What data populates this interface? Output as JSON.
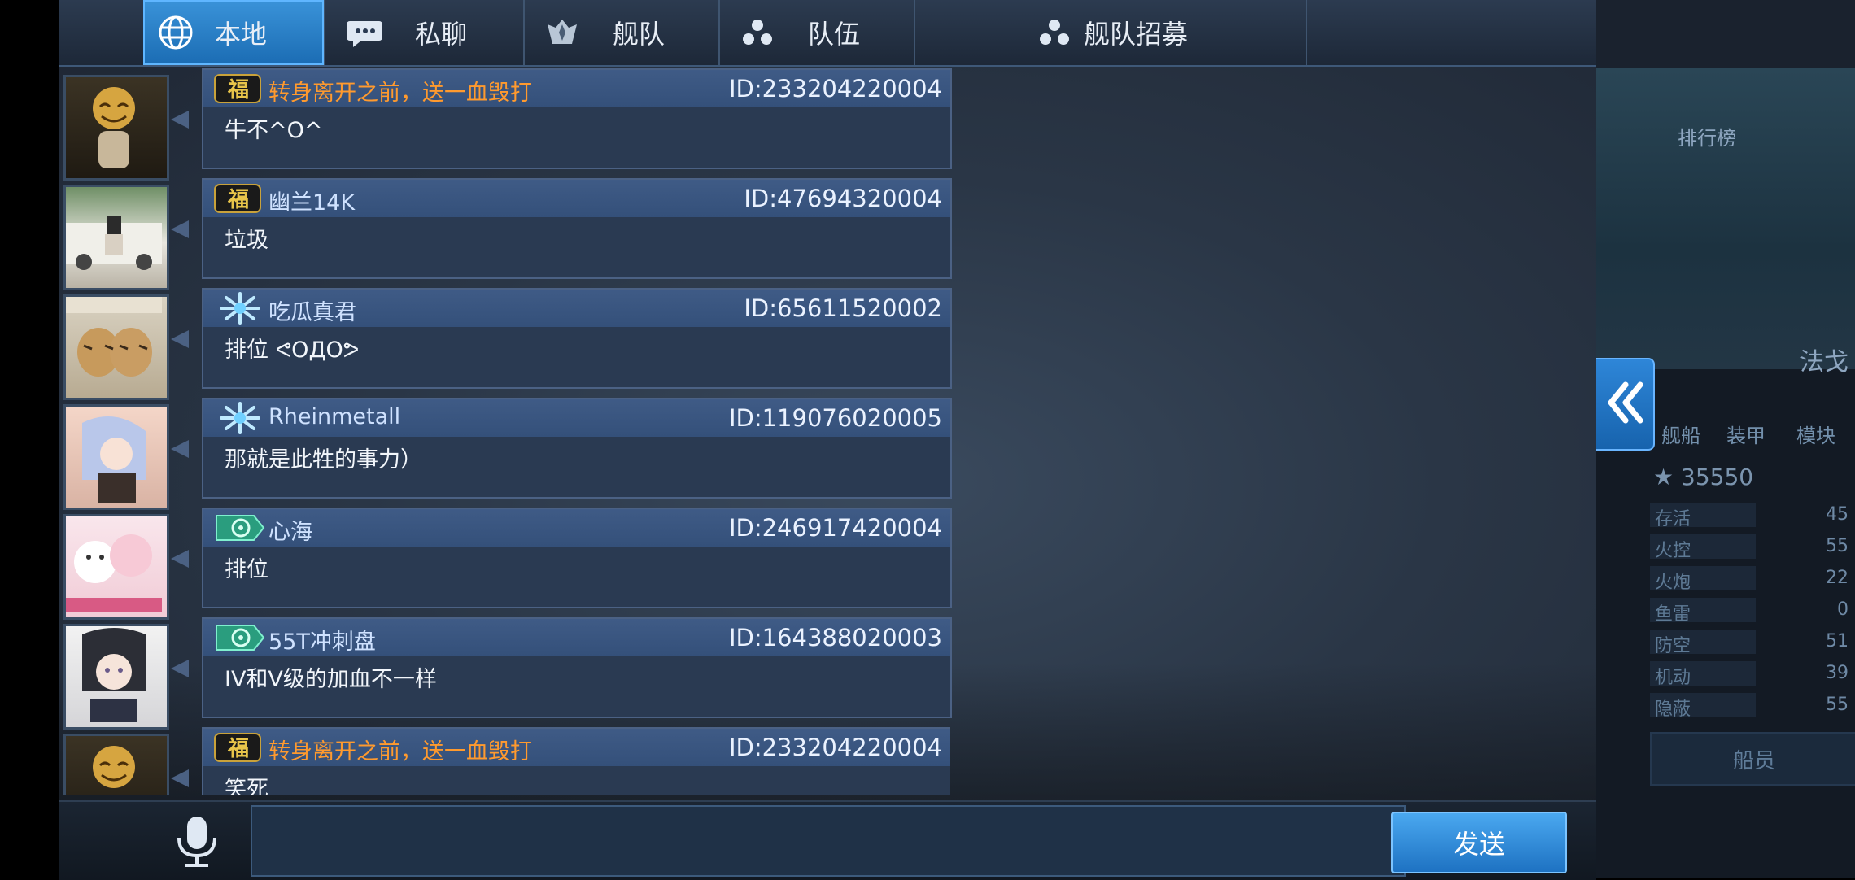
{
  "tabs": [
    {
      "label": "本地",
      "icon": "globe-icon",
      "active": true
    },
    {
      "label": "私聊",
      "icon": "chat-bubble-icon",
      "active": false
    },
    {
      "label": "舰队",
      "icon": "fleet-emblem-icon",
      "active": false
    },
    {
      "label": "队伍",
      "icon": "team-dots-icon",
      "active": false
    },
    {
      "label": "舰队招募",
      "icon": "team-dots-icon",
      "active": false
    }
  ],
  "messages": [
    {
      "username": "转身离开之前，送一血毁打",
      "name_color": "orange",
      "badge": "fu-badge",
      "id": "ID:233204220004",
      "text": "牛不^O^"
    },
    {
      "username": "幽兰14K",
      "name_color": "blue",
      "badge": "fu-badge",
      "id": "ID:47694320004",
      "text": "垃圾"
    },
    {
      "username": "吃瓜真君",
      "name_color": "blue",
      "badge": "ice-badge",
      "id": "ID:65611520002",
      "text": "排位 ᕙOДOᕗ"
    },
    {
      "username": "Rheinmetall",
      "name_color": "blue",
      "badge": "ice-badge",
      "id": "ID:119076020005",
      "text": "那就是此牲的事力）"
    },
    {
      "username": "心海",
      "name_color": "blue",
      "badge": "jade-badge",
      "id": "ID:246917420004",
      "text": "排位"
    },
    {
      "username": "55T冲刺盘",
      "name_color": "blue",
      "badge": "jade-badge",
      "id": "ID:164388020003",
      "text": "IV和V级的加血不一样"
    },
    {
      "username": "转身离开之前，送一血毁打",
      "name_color": "orange",
      "badge": "fu-badge",
      "id": "ID:233204220004",
      "text": "笑死"
    }
  ],
  "input": {
    "value": "",
    "placeholder": ""
  },
  "send_label": "发送",
  "side": {
    "score": "35550",
    "stats": [
      {
        "label": "存活",
        "value": "45"
      },
      {
        "label": "火控",
        "value": "55"
      },
      {
        "label": "火炮",
        "value": "22"
      },
      {
        "label": "鱼雷",
        "value": "0"
      },
      {
        "label": "防空",
        "value": "51"
      },
      {
        "label": "机动",
        "value": "39"
      },
      {
        "label": "隐蔽",
        "value": "55"
      }
    ],
    "crew_label": "船员",
    "tabs": [
      "舰船",
      "装甲",
      "模块"
    ],
    "rank_label": "排行榜",
    "side_title": "法戈"
  },
  "colors": {
    "accent": "#2a7fd0",
    "orange_name": "#ff9a2e",
    "blue_name": "#cfe2ff"
  }
}
